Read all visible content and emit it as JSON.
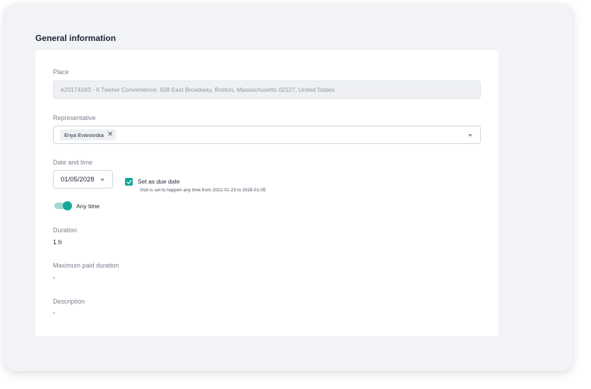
{
  "section": {
    "title": "General information"
  },
  "place": {
    "label": "Place",
    "value": "#20174183 - 6 Twelve Convenience, 628 East Broadway, Boston, Massachusetts 02127, United States"
  },
  "representative": {
    "label": "Representative",
    "selected": [
      {
        "name": "Enya Evanovska"
      }
    ],
    "remove_icon": "close-icon",
    "dropdown_icon": "chevron-down-icon"
  },
  "date_time": {
    "label": "Date and time",
    "date_value": "01/05/2028",
    "due_date": {
      "checked": true,
      "label": "Set as due date",
      "hint": "Visit is set to happen any time from 2022-01-23 to 2028-01-05"
    },
    "any_time": {
      "on": true,
      "label": "Any time"
    }
  },
  "duration": {
    "label": "Duration",
    "value": "1 h"
  },
  "max_paid_duration": {
    "label": "Maximum paid duration",
    "value": "-"
  },
  "description": {
    "label": "Description",
    "value": "-"
  },
  "colors": {
    "accent": "#14a89a",
    "accent_light": "#9fdcd4",
    "panel_bg": "#f2f3f7",
    "card_bg": "#ffffff"
  }
}
